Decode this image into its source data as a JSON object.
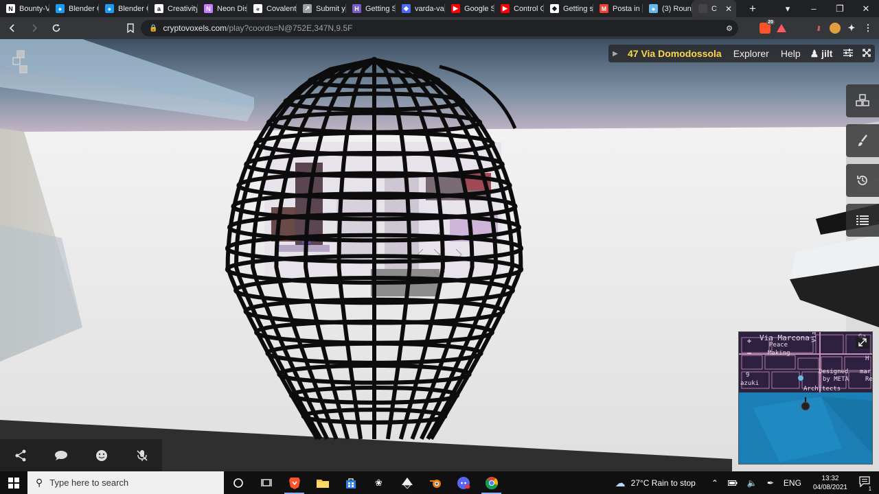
{
  "browser": {
    "tabs": [
      {
        "title": "Bounty-V",
        "icon": "notion-icon",
        "color": "#ffffff"
      },
      {
        "title": "Blender C",
        "icon": "blender-community-icon",
        "color": "#1b9cf2"
      },
      {
        "title": "Blender C",
        "icon": "blender-community-icon",
        "color": "#1b9cf2"
      },
      {
        "title": "Creativity",
        "icon": "amazon-icon",
        "color": "#ffffff"
      },
      {
        "title": "Neon Dis",
        "icon": "neon-icon",
        "color": "#c77dff"
      },
      {
        "title": "Covalent",
        "icon": "covalent-icon",
        "color": "#ffffff"
      },
      {
        "title": "Submit y",
        "icon": "submit-icon",
        "color": "#9aa0a6"
      },
      {
        "title": "Getting S",
        "icon": "hashnode-icon",
        "color": "#7b5cc4"
      },
      {
        "title": "varda-va",
        "icon": "shield-icon",
        "color": "#4a6cf7"
      },
      {
        "title": "Google S",
        "icon": "youtube-icon",
        "color": "#ff0000"
      },
      {
        "title": "Control C",
        "icon": "youtube-icon",
        "color": "#ff0000"
      },
      {
        "title": "Getting s",
        "icon": "gitbook-icon",
        "color": "#ffffff"
      },
      {
        "title": "Posta in",
        "icon": "gmail-icon",
        "color": "#ea4335"
      },
      {
        "title": "(3) Roun",
        "icon": "globe-icon",
        "color": "#6ab8e8"
      }
    ],
    "active_tab": {
      "title": "C",
      "icon": "cryptovoxels-icon"
    },
    "new_tab_label": "+",
    "url_host": "cryptovoxels.com",
    "url_rest": "/play?coords=N@752E,347N,9.5F",
    "extension_badge": "20"
  },
  "hud": {
    "parcel_name": "47 Via Domodossola",
    "explorer_label": "Explorer",
    "help_label": "Help",
    "user_name": "jilt"
  },
  "minimap": {
    "labels": {
      "via_marcona": "Via Marcona",
      "peace": "Peace",
      "making": "Making",
      "designed": "Designed",
      "by_meta": "by META",
      "architects": "Architects",
      "azuki": "azuki",
      "via_d": "Via D",
      "nine": "9",
      "ga": "Ga",
      "h": "H",
      "mar": "mar",
      "re": "Re"
    },
    "zoom_in": "+",
    "zoom_out": "−",
    "colors": {
      "land": "#2e2040",
      "water": "#1b7fb5",
      "roads": "#c58fb5"
    }
  },
  "taskbar": {
    "search_placeholder": "Type here to search",
    "weather": "27°C  Rain to stop",
    "language": "ENG",
    "time": "13:32",
    "date": "04/08/2021",
    "notification_count": "1"
  },
  "colors": {
    "parcel_name": "#ffd84a",
    "hud_bg": "#282828"
  }
}
